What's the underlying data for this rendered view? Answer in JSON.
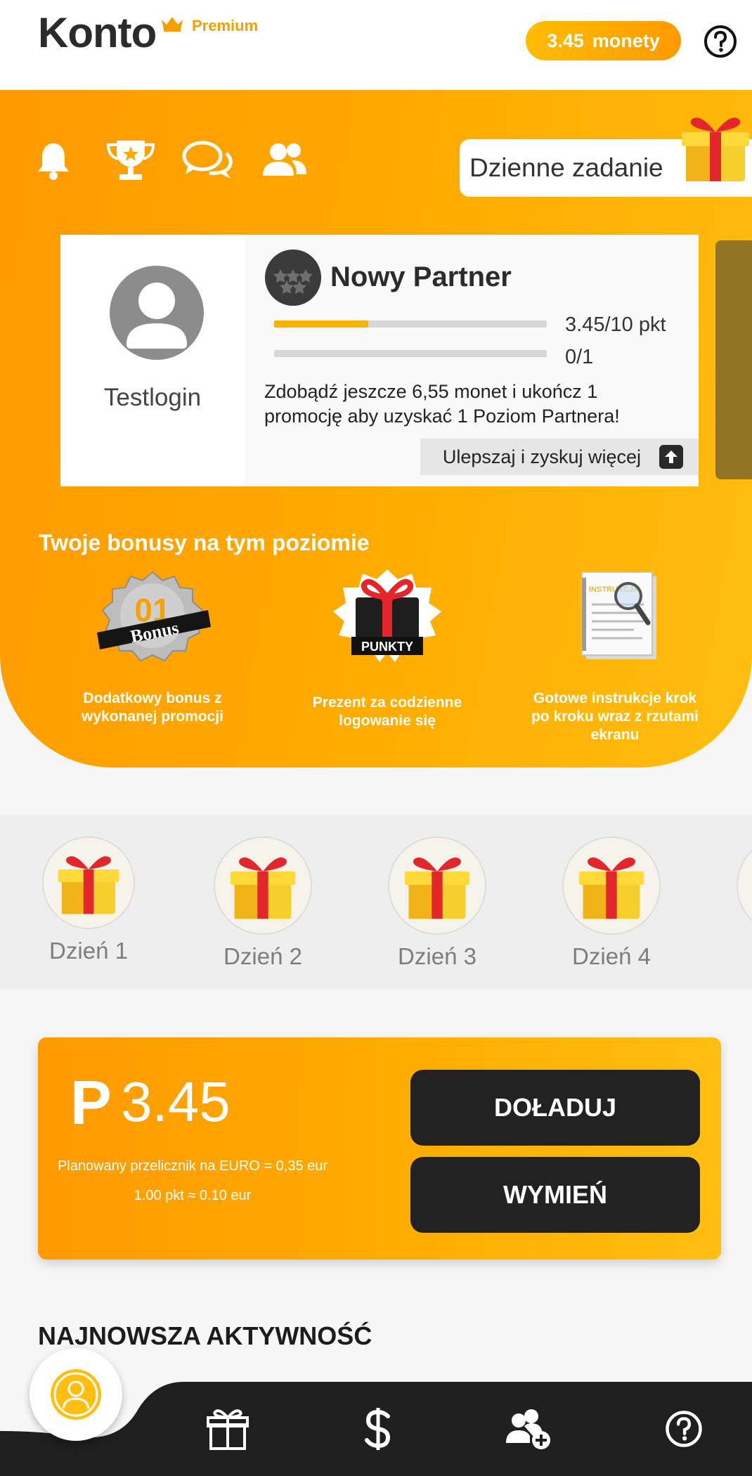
{
  "header": {
    "title": "Konto",
    "premium_label": "Premium",
    "coins_value": "3.45",
    "coins_unit": "monety"
  },
  "hero": {
    "icons": [
      "bell-icon",
      "trophy-icon",
      "chat-icon",
      "users-icon"
    ],
    "daily_task_label": "Dzienne zadanie",
    "partner": {
      "username": "Testlogin",
      "rank_title": "Nowy Partner",
      "points_progress": 0.345,
      "points_label": "3.45/10 pkt",
      "promo_progress": 0,
      "promo_label": "0/1",
      "description": "Zdobądź jeszcze 6,55 monet i ukończ 1 promocję aby uzyskać 1 Poziom Partnera!",
      "upgrade_label": "Ulepszaj i zyskuj więcej"
    },
    "bonus_heading": "Twoje bonusy na tym poziomie",
    "bonuses": [
      {
        "image_text_top": "01",
        "image_text": "Bonus",
        "caption": "Dodatkowy bonus z wykonanej promocji"
      },
      {
        "image_text": "PUNKTY",
        "caption": "Prezent za codzienne logowanie się"
      },
      {
        "image_text": "INSTRUKCJA",
        "caption": "Gotowe instrukcje krok po kroku wraz z rzutami ekranu"
      }
    ]
  },
  "days": [
    "Dzień 1",
    "Dzień 2",
    "Dzień 3",
    "Dzień 4"
  ],
  "wallet": {
    "currency_symbol": "P",
    "amount": "3.45",
    "rate_line1": "Planowany przelicznik na EURO = 0,35 eur",
    "rate_line2": "1.00 pkt ≈ 0.10 eur",
    "topup_label": "DOŁADUJ",
    "exchange_label": "WYMIEŃ"
  },
  "latest_activity_heading": "NAJNOWSZA AKTYWNOŚĆ",
  "bottom_nav": [
    "profile-icon",
    "gift-icon",
    "dollar-icon",
    "add-user-icon",
    "help-icon"
  ],
  "colors": {
    "accent": "#ffac00",
    "accent_dark": "#ff9a00",
    "dark": "#222222"
  }
}
